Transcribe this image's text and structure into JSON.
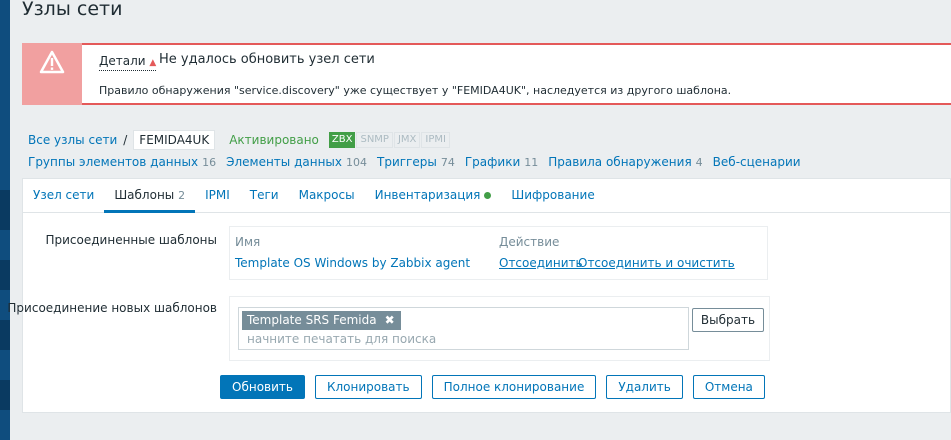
{
  "title": "Узлы сети",
  "message": {
    "details_label": "Детали",
    "title": "Не удалось обновить узел сети",
    "text": "Правило обнаружения \"service.discovery\" уже существует у \"FEMIDA4UK\", наследуется из другого шаблона.",
    "color": "#e45959"
  },
  "breadcrumbs": {
    "all_hosts": "Все узлы сети",
    "separator": "/",
    "current": "FEMIDA4UK",
    "status": "Активировано",
    "availability": [
      "ZBX",
      "SNMP",
      "JMX",
      "IPMI"
    ]
  },
  "host_items": [
    {
      "label": "Группы элементов данных",
      "count": "16"
    },
    {
      "label": "Элементы данных",
      "count": "104"
    },
    {
      "label": "Триггеры",
      "count": "74"
    },
    {
      "label": "Графики",
      "count": "11"
    },
    {
      "label": "Правила обнаружения",
      "count": "4"
    },
    {
      "label": "Веб-сценарии",
      "count": ""
    }
  ],
  "tabs": [
    {
      "label": "Узел сети",
      "count": ""
    },
    {
      "label": "Шаблоны",
      "count": "2"
    },
    {
      "label": "IPMI",
      "count": ""
    },
    {
      "label": "Теги",
      "count": ""
    },
    {
      "label": "Макросы",
      "count": ""
    },
    {
      "label": "Инвентаризация",
      "count": ""
    },
    {
      "label": "Шифрование",
      "count": ""
    }
  ],
  "linked_templates": {
    "label": "Присоединенные шаблоны",
    "col_name": "Имя",
    "col_action": "Действие",
    "template_name": "Template OS Windows by Zabbix agent",
    "unlink": "Отсоединить",
    "unlink_clear": "Отсоединить и очистить"
  },
  "new_templates": {
    "label": "Присоединение новых шаблонов",
    "chip": "Template SRS Femida",
    "placeholder": "начните печатать для поиска",
    "select_button": "Выбрать"
  },
  "buttons": {
    "update": "Обновить",
    "clone": "Клонировать",
    "full_clone": "Полное клонирование",
    "delete": "Удалить",
    "cancel": "Отмена"
  },
  "colors": {
    "accent": "#0275b8",
    "green": "#429e47",
    "error": "#e45959"
  }
}
